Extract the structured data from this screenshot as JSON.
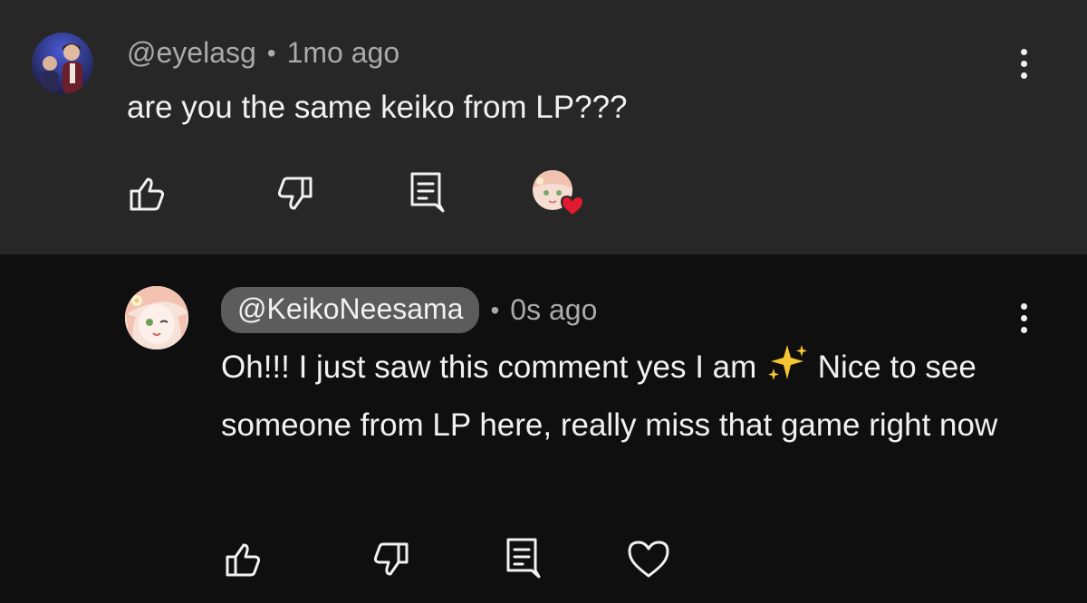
{
  "comment": {
    "author": "@eyelasg",
    "separator": "•",
    "time": "1mo ago",
    "text": "are you the same keiko from LP???",
    "avatar_icon": "user-avatar-photo",
    "actions": [
      "like",
      "dislike",
      "reply",
      "creator-heart"
    ]
  },
  "reply": {
    "author": "@KeikoNeesama",
    "separator": "•",
    "time": "0s ago",
    "text_part1": "Oh!!! I just saw this comment yes I am ",
    "emoji": "sparkles",
    "text_part2": " Nice to see someone from LP here, really miss that game right now",
    "avatar_icon": "anime-girl-avatar",
    "actions": [
      "like",
      "dislike",
      "reply",
      "heart"
    ]
  },
  "colors": {
    "top_bg": "#272727",
    "reply_bg": "#0f0f0f",
    "text": "#f1f1f1",
    "secondary_text": "#aaaaaa",
    "pill_bg": "#5c5c5c",
    "heart_red": "#e3192f"
  }
}
